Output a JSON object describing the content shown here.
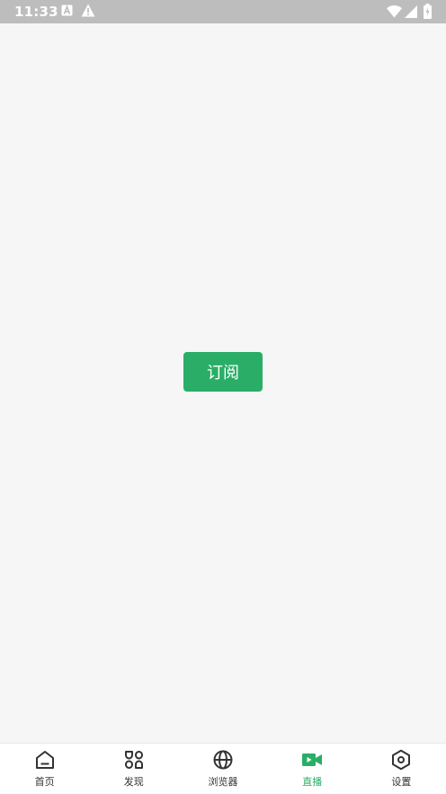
{
  "status_bar": {
    "time": "11:33",
    "icons": [
      "a-notification-icon",
      "warning-icon",
      "wifi-icon",
      "signal-icon",
      "battery-icon"
    ]
  },
  "main": {
    "subscribe_label": "订阅"
  },
  "bottom_nav": {
    "items": [
      {
        "label": "首页",
        "icon": "home-icon",
        "active": false
      },
      {
        "label": "发现",
        "icon": "discover-icon",
        "active": false
      },
      {
        "label": "浏览器",
        "icon": "globe-icon",
        "active": false
      },
      {
        "label": "直播",
        "icon": "video-camera-icon",
        "active": true
      },
      {
        "label": "设置",
        "icon": "settings-hexagon-icon",
        "active": false
      }
    ]
  },
  "colors": {
    "accent": "#2aae67",
    "status_bar": "#bdbdbd",
    "background": "#f6f6f6",
    "nav_text": "#333333"
  }
}
